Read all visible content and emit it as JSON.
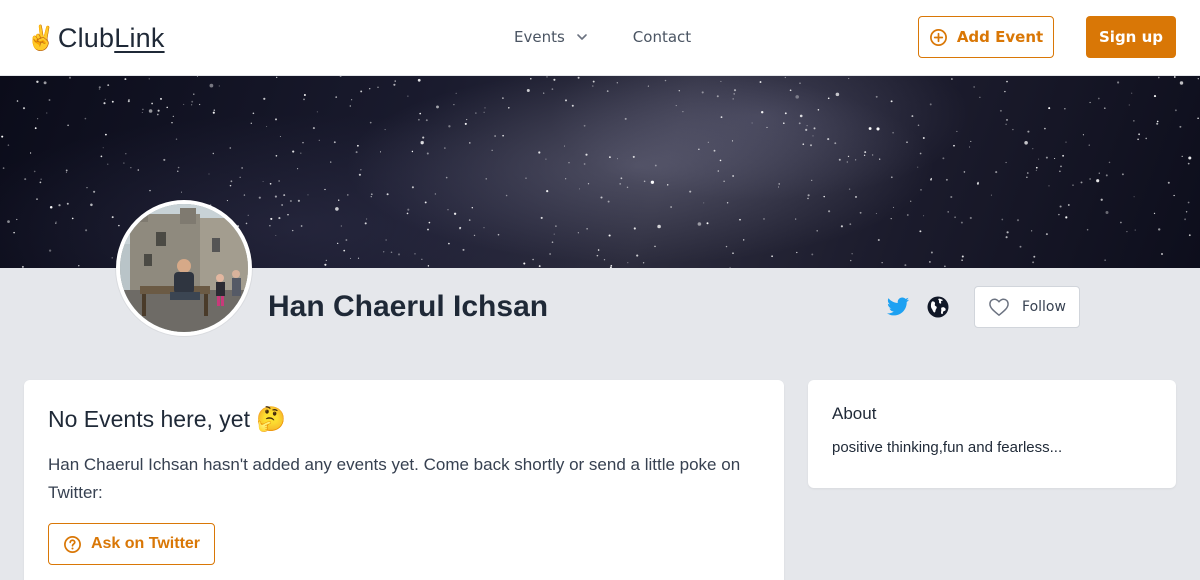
{
  "header": {
    "logo_emoji": "✌️",
    "logo_club": "Club",
    "logo_link": "Link",
    "nav": [
      {
        "label": "Events",
        "has_dropdown": true
      },
      {
        "label": "Contact",
        "has_dropdown": false
      }
    ],
    "add_event_label": "Add Event",
    "signup_label": "Sign up"
  },
  "profile": {
    "name": "Han Chaerul Ichsan",
    "follow_label": "Follow",
    "icons": [
      "twitter-icon",
      "globe-icon",
      "heart-icon"
    ]
  },
  "events_card": {
    "title": "No Events here, yet",
    "title_emoji": "🤔",
    "message": "Han Chaerul Ichsan hasn't added any events yet. Come back shortly or send a little poke on Twitter:",
    "ask_label": "Ask on Twitter"
  },
  "about_card": {
    "title": "About",
    "text": "positive thinking,fun and fearless..."
  },
  "colors": {
    "accent": "#d97706",
    "background": "#e5e7eb",
    "twitter": "#1da1f2"
  }
}
